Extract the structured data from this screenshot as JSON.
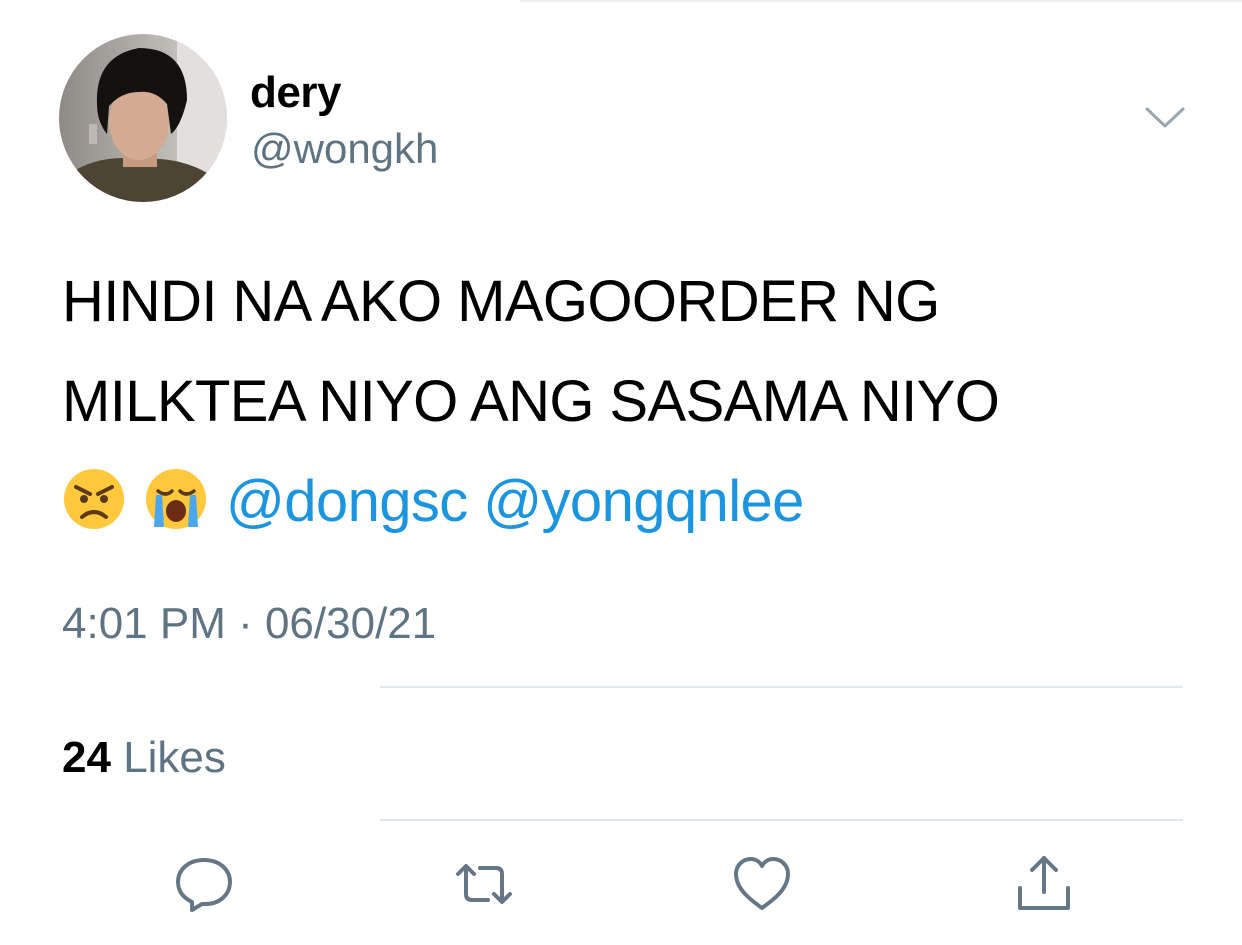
{
  "user": {
    "display_name": "dery",
    "handle": "@wongkh",
    "avatar_icon": "profile-photo"
  },
  "tweet": {
    "line1": "HINDI NA AKO MAGOORDER NG",
    "line2": "MILKTEA NIYO ANG SASAMA NIYO",
    "emojis": [
      "angry-face-emoji",
      "loudly-crying-face-emoji"
    ],
    "mentions": [
      "@dongsc",
      "@yongqnlee"
    ],
    "timestamp": "4:01 PM · 06/30/21"
  },
  "stats": {
    "likes_count": "24",
    "likes_label": "Likes"
  },
  "actions": [
    "reply-icon",
    "retweet-icon",
    "like-icon",
    "share-icon"
  ],
  "colors": {
    "mention": "#1b95e0",
    "secondary_text": "#5f7482",
    "divider": "#e1e8ed",
    "icon": "#657786"
  }
}
